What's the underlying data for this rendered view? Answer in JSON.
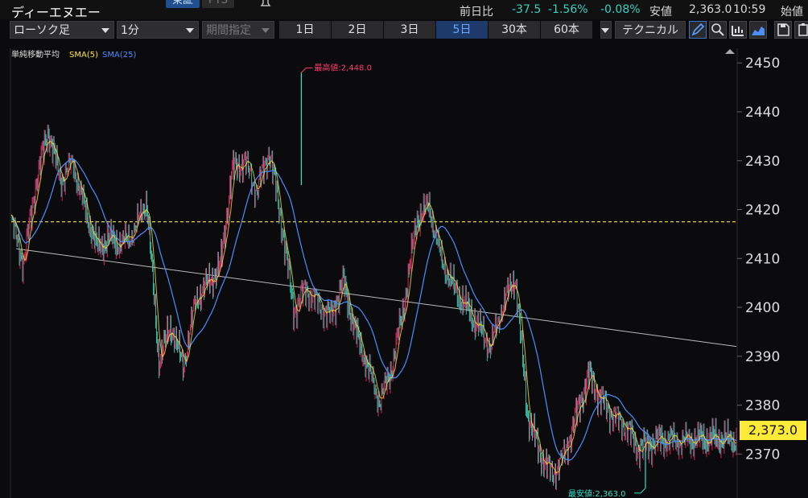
{
  "header": {
    "symbol_name": "ディーエヌエー",
    "exchange_tabs": [
      "東証",
      "PTS"
    ],
    "quote": {
      "prev_close_label": "前日比",
      "change": "-37.5",
      "change_pct": "-1.56%",
      "change_pct2": "-0.08%",
      "low_label": "安値",
      "low_value": "2,363.0",
      "time": "10:59",
      "open_label": "始値"
    }
  },
  "toolbar": {
    "chart_type": "ローソク足",
    "interval": "1分",
    "period_placeholder": "期間指定",
    "range_buttons": [
      "1日",
      "2日",
      "3日",
      "5日",
      "30本",
      "60本"
    ],
    "range_selected": "5日",
    "technical_label": "テクニカル",
    "icons": [
      "pen-icon",
      "zoom-icon",
      "volume-icon",
      "mountain-chart-icon",
      "save-icon",
      "clipboard-icon"
    ]
  },
  "chart": {
    "legend": {
      "title": "単純移動平均",
      "sma5": "SMA(5)",
      "sma25": "SMA(25)"
    },
    "high_annotation": "最高値:2,448.0",
    "low_annotation": "最安値:2,363.0",
    "current_price_label": "2,373.0",
    "reference_line_value": 2417.5,
    "colors": {
      "sma5": "#ffe23a",
      "sma25": "#4c8dff",
      "up": "#ff2a6d",
      "down": "#33e0c8",
      "ref": "#ffe23a"
    }
  },
  "chart_data": {
    "type": "line",
    "y_ticks": [
      2450,
      2440,
      2430,
      2420,
      2410,
      2400,
      2390,
      2380,
      2370
    ],
    "ylim": [
      2361,
      2453
    ],
    "x": [
      0,
      5,
      10,
      15,
      20,
      25,
      30,
      35,
      40,
      45,
      50,
      55,
      60,
      65,
      70,
      75,
      80,
      85,
      90,
      95,
      100,
      105,
      110,
      115,
      120,
      125,
      130,
      135,
      140,
      145,
      150,
      155,
      160,
      165,
      170,
      175,
      180,
      185,
      190,
      195,
      200,
      205,
      210,
      215,
      220,
      225,
      230,
      235,
      240,
      245,
      250,
      255,
      260,
      265,
      270,
      275,
      280,
      285,
      290,
      295
    ],
    "series": [
      {
        "name": "price",
        "values": [
          2418,
          2409,
          2425,
          2436,
          2426,
          2430,
          2420,
          2412,
          2414,
          2413,
          2416,
          2422,
          2389,
          2396,
          2388,
          2402,
          2405,
          2408,
          2428,
          2430,
          2424,
          2432,
          2417,
          2399,
          2404,
          2401,
          2398,
          2405,
          2395,
          2388,
          2381,
          2388,
          2401,
          2418,
          2421,
          2410,
          2404,
          2400,
          2396,
          2392,
          2401,
          2406,
          2378,
          2370,
          2366,
          2370,
          2378,
          2386,
          2381,
          2378,
          2376,
          2371,
          2372,
          2373,
          2373,
          2373,
          2373,
          2373,
          2373,
          2373
        ]
      }
    ],
    "trendline": {
      "start": [
        2,
        2412
      ],
      "end": [
        295,
        2392
      ]
    },
    "high_point": {
      "x": 118,
      "y": 2448
    },
    "low_point": {
      "x": 258,
      "y": 2363
    }
  }
}
